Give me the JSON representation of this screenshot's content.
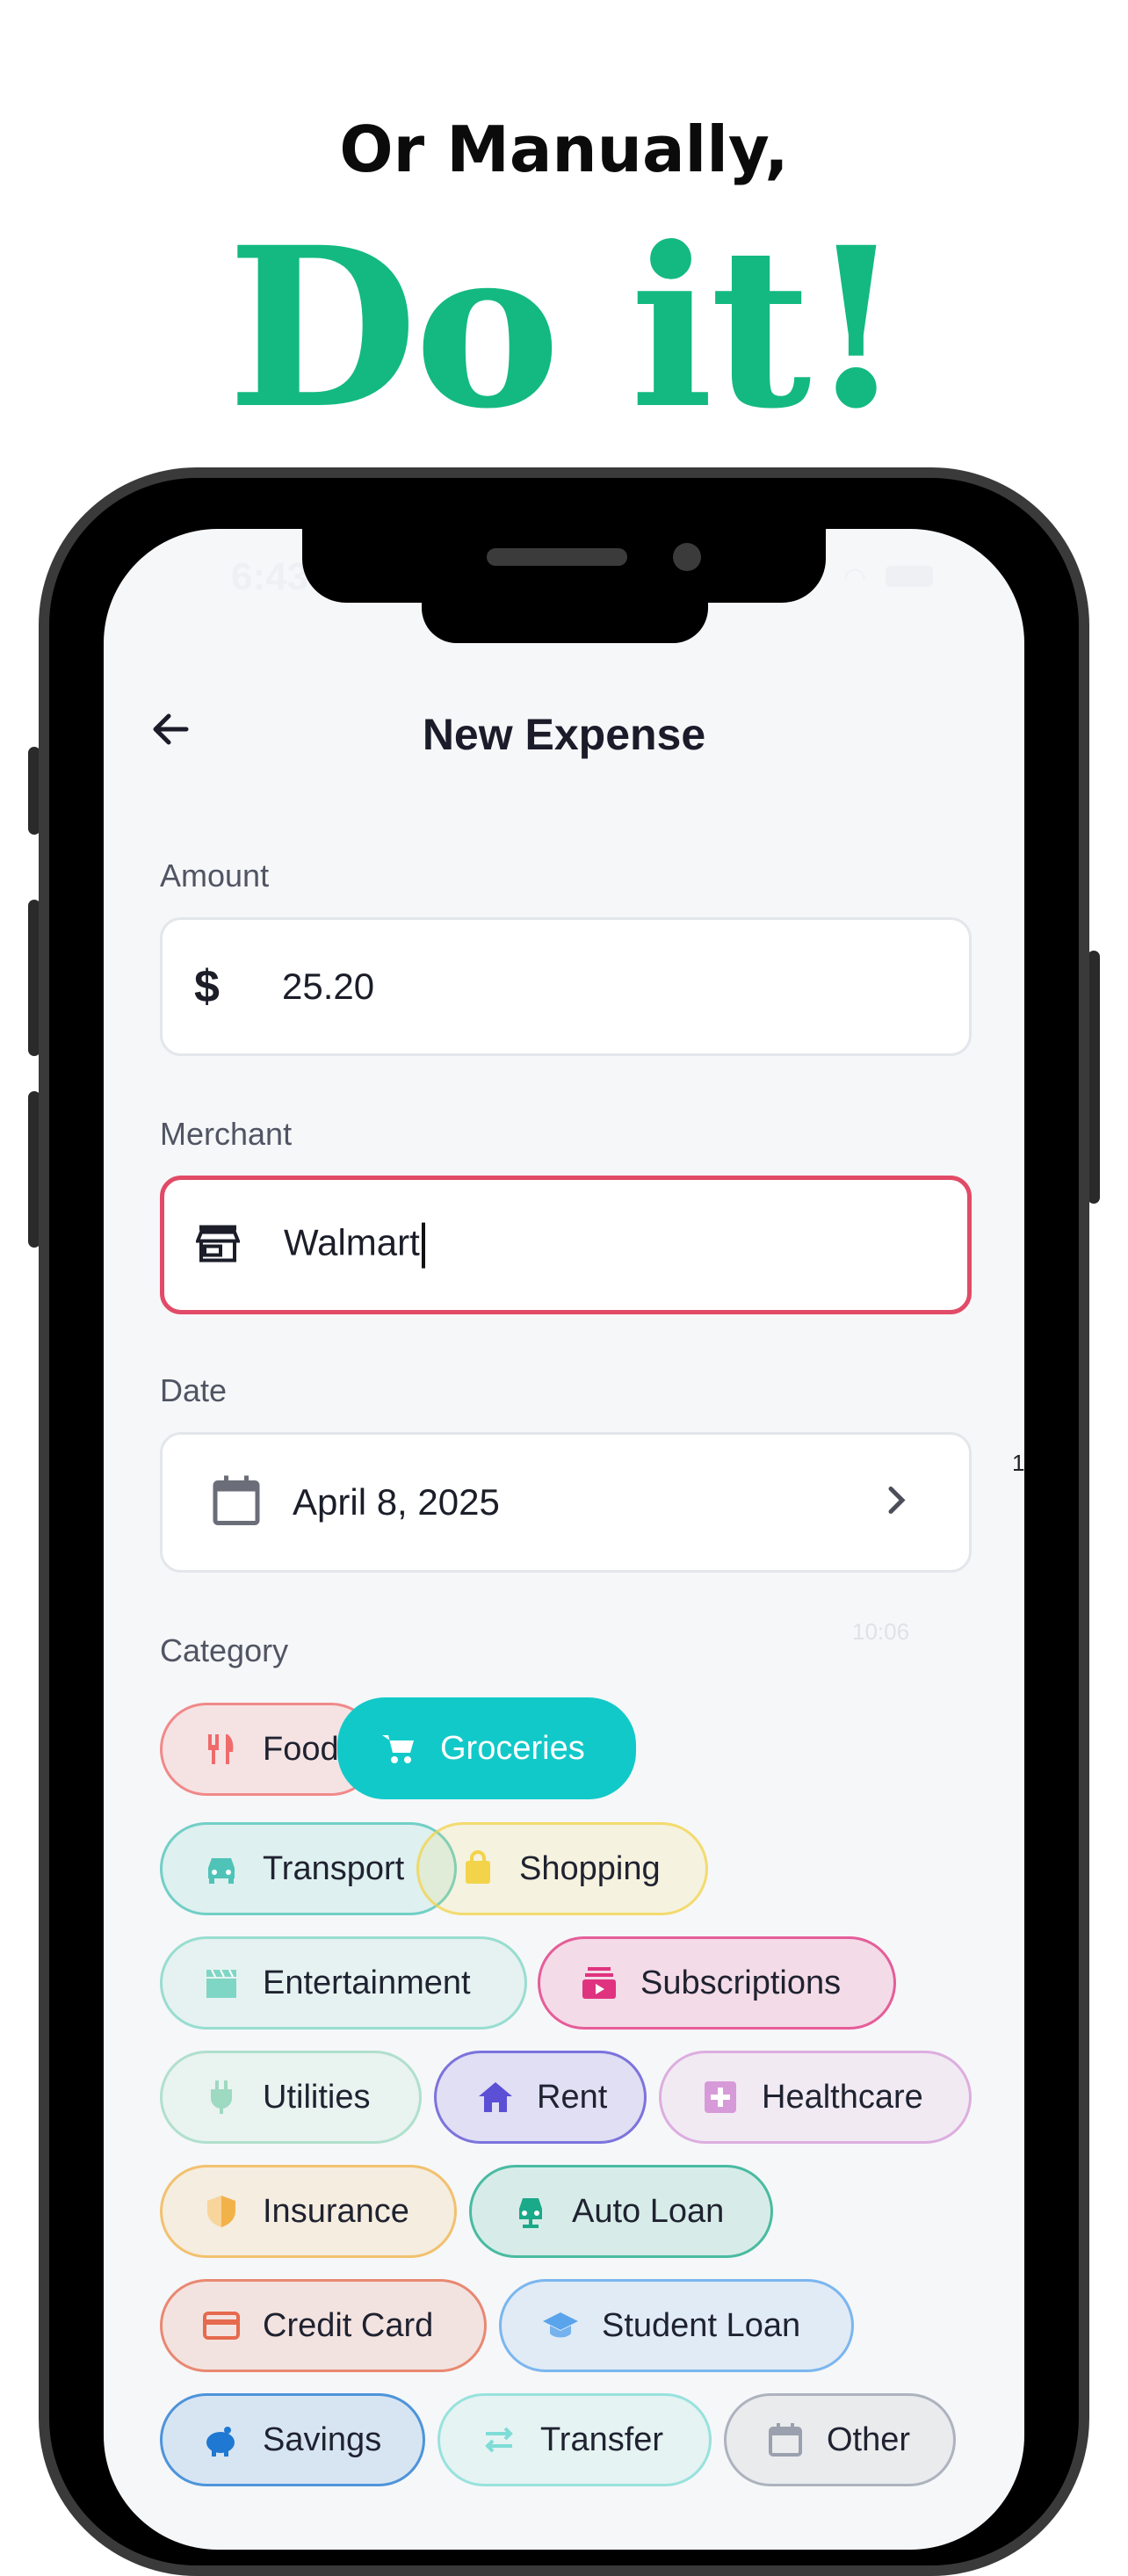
{
  "headline": "Or Manually,",
  "hero": "Do it!",
  "status": {
    "time": "6:43"
  },
  "screen": {
    "title": "New Expense",
    "amount": {
      "label": "Amount",
      "currency_symbol": "$",
      "value": "25.20"
    },
    "merchant": {
      "label": "Merchant",
      "value": "Walmart"
    },
    "date": {
      "label": "Date",
      "value": "April 8, 2025"
    },
    "category": {
      "label": "Category",
      "items": [
        {
          "label": "Food",
          "icon": "fork-knife-icon",
          "color": "#ef6b6b"
        },
        {
          "label": "Groceries",
          "icon": "cart-icon",
          "color": "#12c9c9",
          "selected": true
        },
        {
          "label": "Transport",
          "icon": "car-icon",
          "color": "#4fc3b8"
        },
        {
          "label": "Shopping",
          "icon": "shopping-bag-icon",
          "color": "#f3d34a"
        },
        {
          "label": "Entertainment",
          "icon": "clapper-icon",
          "color": "#7fd6c4"
        },
        {
          "label": "Subscriptions",
          "icon": "subscriptions-icon",
          "color": "#e0337f"
        },
        {
          "label": "Utilities",
          "icon": "plug-icon",
          "color": "#9ed9c2"
        },
        {
          "label": "Rent",
          "icon": "home-icon",
          "color": "#5b4fd6"
        },
        {
          "label": "Healthcare",
          "icon": "medical-cross-icon",
          "color": "#d79ad8"
        },
        {
          "label": "Insurance",
          "icon": "shield-icon",
          "color": "#f2b24a"
        },
        {
          "label": "Auto Loan",
          "icon": "car-loan-icon",
          "color": "#1aa989"
        },
        {
          "label": "Credit Card",
          "icon": "credit-card-icon",
          "color": "#e56a4e"
        },
        {
          "label": "Student Loan",
          "icon": "graduation-cap-icon",
          "color": "#5aa4ec"
        },
        {
          "label": "Savings",
          "icon": "piggy-bank-icon",
          "color": "#1f78d1"
        },
        {
          "label": "Transfer",
          "icon": "transfer-icon",
          "color": "#7fdcd6"
        },
        {
          "label": "Other",
          "icon": "calendar-icon",
          "color": "#9aa0ad"
        }
      ]
    },
    "ghost_time": "10:06",
    "edge_digit": "1"
  }
}
